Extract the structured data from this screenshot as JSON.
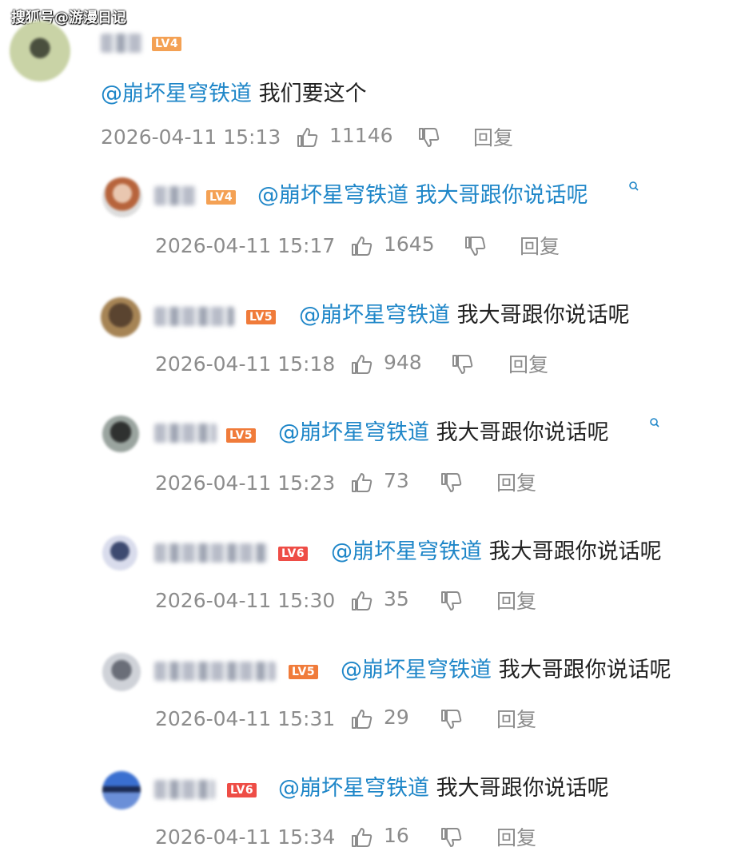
{
  "watermark": "搜狐号@游漫日记",
  "colors": {
    "mention": "#1e86c8",
    "meta": "#8c8c8c",
    "lv4": "#f4a154",
    "lv5": "#f07b3a",
    "lv6": "#ee4d46"
  },
  "main_comment": {
    "level": "LV4",
    "mention": "@崩坏星穹铁道",
    "text": " 我们要这个",
    "time": "2026-04-11 15:13",
    "likes": "11146",
    "reply_label": "回复"
  },
  "replies": [
    {
      "level": "LV4",
      "mention": "@崩坏星穹铁道",
      "text": " 我大哥跟你说话呢",
      "time": "2026-04-11 15:17",
      "likes": "1645",
      "reply_label": "回复"
    },
    {
      "level": "LV5",
      "mention": "@崩坏星穹铁道",
      "text": " 我大哥跟你说话呢",
      "time": "2026-04-11 15:18",
      "likes": "948",
      "reply_label": "回复"
    },
    {
      "level": "LV5",
      "mention": "@崩坏星穹铁道",
      "text": " 我大哥跟你说话呢",
      "time": "2026-04-11 15:23",
      "likes": "73",
      "reply_label": "回复"
    },
    {
      "level": "LV6",
      "mention": "@崩坏星穹铁道",
      "text": " 我大哥跟你说话呢",
      "time": "2026-04-11 15:30",
      "likes": "35",
      "reply_label": "回复"
    },
    {
      "level": "LV5",
      "mention": "@崩坏星穹铁道",
      "text": " 我大哥跟你说话呢",
      "time": "2026-04-11 15:31",
      "likes": "29",
      "reply_label": "回复"
    },
    {
      "level": "LV6",
      "mention": "@崩坏星穹铁道",
      "text": " 我大哥跟你说话呢",
      "time": "2026-04-11 15:34",
      "likes": "16",
      "reply_label": "回复"
    }
  ],
  "icons": {
    "like": "thumbs-up-icon",
    "dislike": "thumbs-down-icon",
    "search": "search-icon"
  }
}
